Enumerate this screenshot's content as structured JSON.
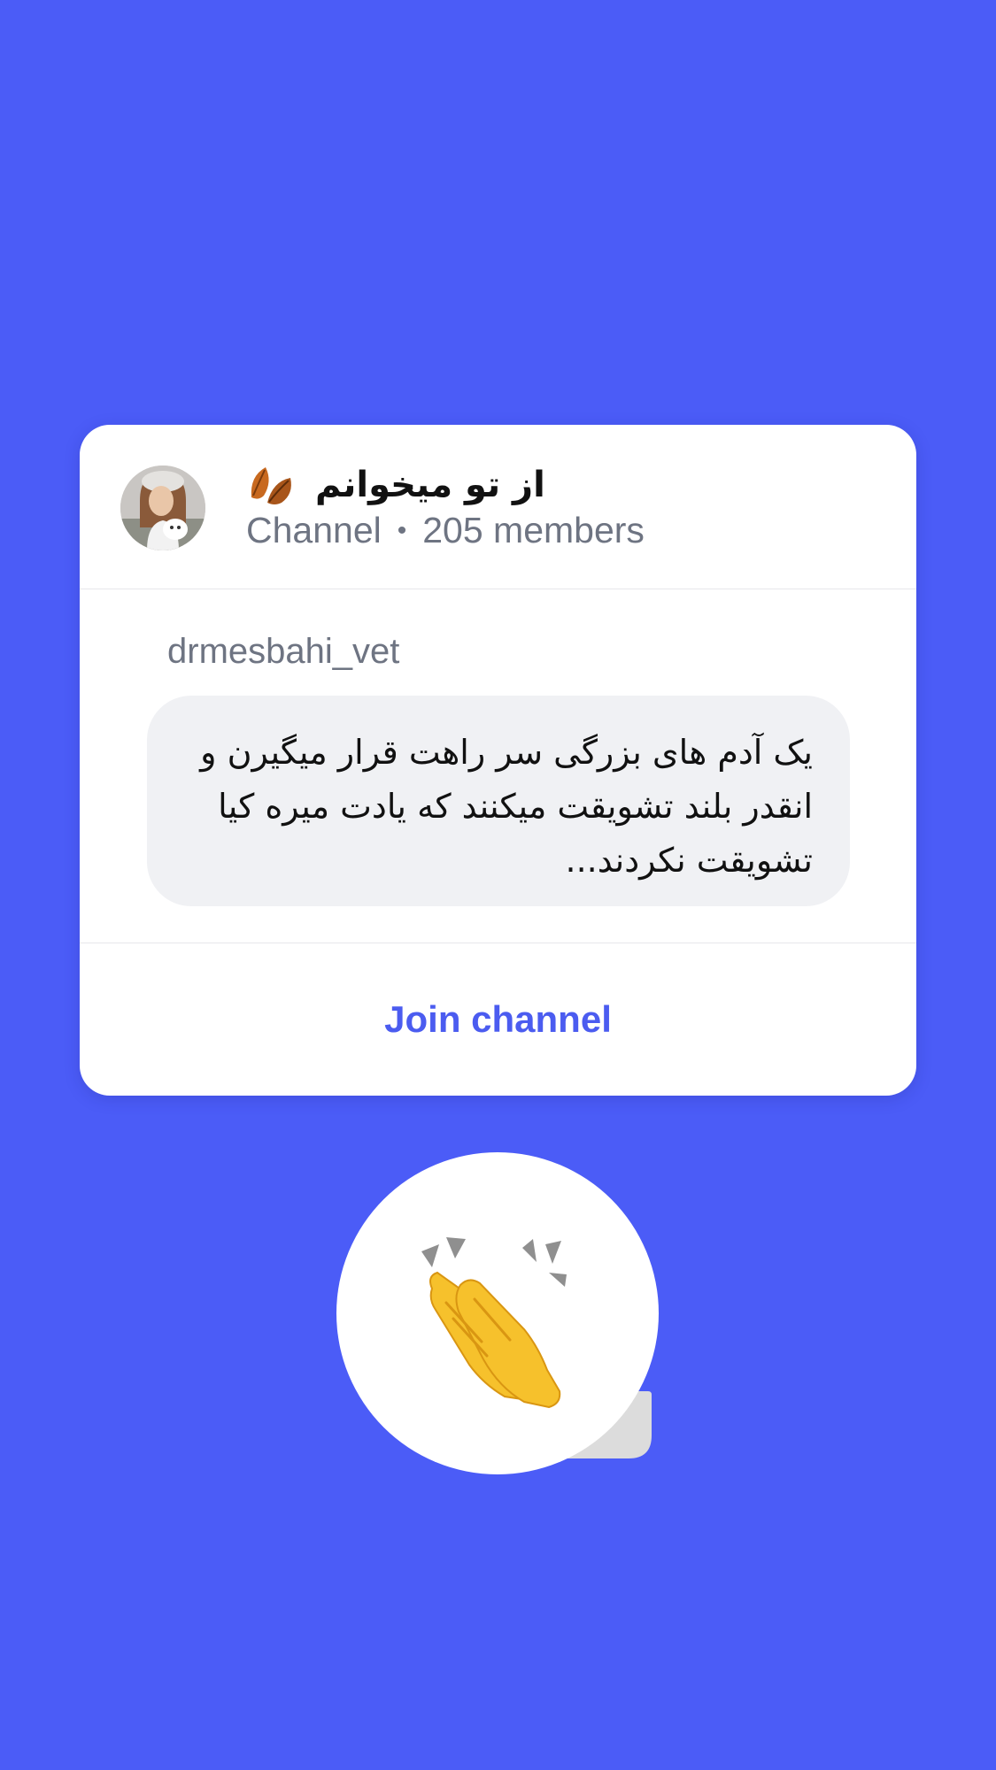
{
  "channel": {
    "name": "از تو میخوانم",
    "name_icon": "fallen-leaf-icon",
    "type_label": "Channel",
    "separator": "•",
    "members_label": "205 members"
  },
  "post": {
    "author": "drmesbahi_vet",
    "message": "یک آدم های بزرگی سر راهت قرار میگیرن و انقدر بلند تشویقت میکنند که یادت میره کیا تشویقت نکردند..."
  },
  "actions": {
    "join_label": "Join channel"
  },
  "sticker": {
    "icon": "clapping-hands-icon"
  },
  "colors": {
    "background": "#4b5cf7",
    "accent": "#4b5cf0",
    "card": "#ffffff",
    "bubble": "#f0f1f4"
  }
}
